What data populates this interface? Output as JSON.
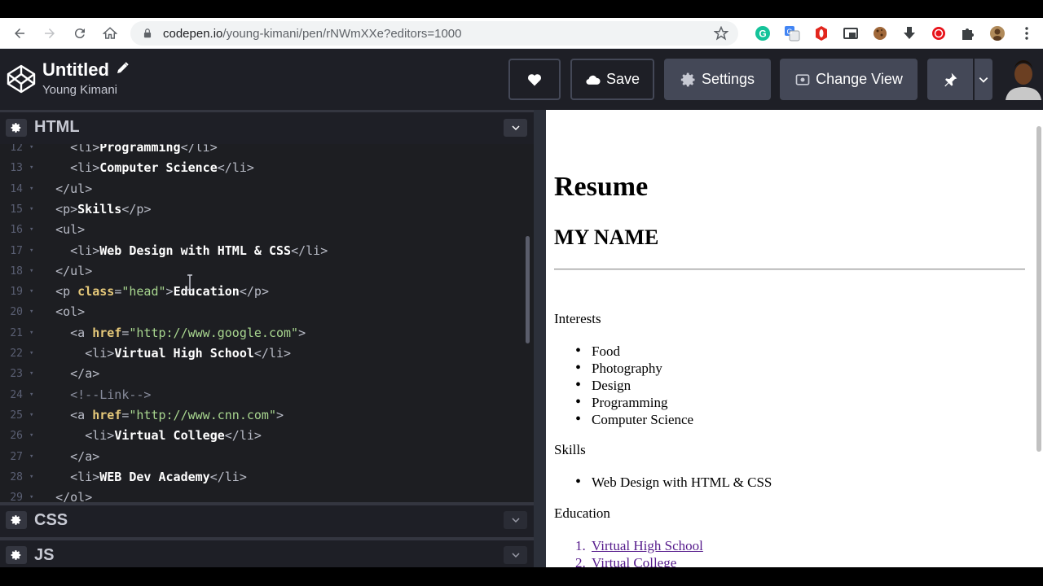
{
  "browser": {
    "url_host": "codepen.io",
    "url_path": "/young-kimani/pen/rNWmXXe?editors=1000",
    "extensions": [
      "grammarly-icon",
      "translate-icon",
      "opera-icon",
      "window-icon",
      "cookie-icon",
      "download-icon",
      "record-icon",
      "puzzle-icon",
      "profile-icon",
      "menu-icon"
    ]
  },
  "header": {
    "title": "Untitled",
    "author": "Young Kimani",
    "save_label": "Save",
    "settings_label": "Settings",
    "change_view_label": "Change View"
  },
  "editor": {
    "html_label": "HTML",
    "css_label": "CSS",
    "js_label": "JS",
    "lines": [
      {
        "n": "12",
        "indent": "    ",
        "parts": [
          [
            "t",
            "<"
          ],
          [
            "tn",
            "li"
          ],
          [
            "t",
            ">"
          ],
          [
            "c",
            "Programming"
          ],
          [
            "t",
            "</"
          ],
          [
            "tn",
            "li"
          ],
          [
            "t",
            ">"
          ]
        ]
      },
      {
        "n": "13",
        "indent": "    ",
        "parts": [
          [
            "t",
            "<"
          ],
          [
            "tn",
            "li"
          ],
          [
            "t",
            ">"
          ],
          [
            "c",
            "Computer Science"
          ],
          [
            "t",
            "</"
          ],
          [
            "tn",
            "li"
          ],
          [
            "t",
            ">"
          ]
        ]
      },
      {
        "n": "14",
        "indent": "  ",
        "parts": [
          [
            "t",
            "</"
          ],
          [
            "tn",
            "ul"
          ],
          [
            "t",
            ">"
          ]
        ]
      },
      {
        "n": "15",
        "indent": "  ",
        "parts": [
          [
            "t",
            "<"
          ],
          [
            "tn",
            "p"
          ],
          [
            "t",
            ">"
          ],
          [
            "c",
            "Skills"
          ],
          [
            "t",
            "</"
          ],
          [
            "tn",
            "p"
          ],
          [
            "t",
            ">"
          ]
        ]
      },
      {
        "n": "16",
        "indent": "  ",
        "parts": [
          [
            "t",
            "<"
          ],
          [
            "tn",
            "ul"
          ],
          [
            "t",
            ">"
          ]
        ]
      },
      {
        "n": "17",
        "indent": "    ",
        "parts": [
          [
            "t",
            "<"
          ],
          [
            "tn",
            "li"
          ],
          [
            "t",
            ">"
          ],
          [
            "c",
            "Web Design with HTML & CSS"
          ],
          [
            "t",
            "</"
          ],
          [
            "tn",
            "li"
          ],
          [
            "t",
            ">"
          ]
        ]
      },
      {
        "n": "18",
        "indent": "  ",
        "parts": [
          [
            "t",
            "</"
          ],
          [
            "tn",
            "ul"
          ],
          [
            "t",
            ">"
          ]
        ]
      },
      {
        "n": "19",
        "indent": "  ",
        "parts": [
          [
            "t",
            "<"
          ],
          [
            "tn",
            "p"
          ],
          [
            "c",
            " "
          ],
          [
            "attr",
            "class"
          ],
          [
            "t",
            "="
          ],
          [
            "str",
            "\"head\""
          ],
          [
            "t",
            ">"
          ],
          [
            "c",
            "Education"
          ],
          [
            "t",
            "</"
          ],
          [
            "tn",
            "p"
          ],
          [
            "t",
            ">"
          ]
        ]
      },
      {
        "n": "20",
        "indent": "  ",
        "parts": [
          [
            "t",
            "<"
          ],
          [
            "tn",
            "ol"
          ],
          [
            "t",
            ">"
          ]
        ]
      },
      {
        "n": "21",
        "indent": "    ",
        "parts": [
          [
            "t",
            "<"
          ],
          [
            "tn",
            "a"
          ],
          [
            "c",
            " "
          ],
          [
            "attr",
            "href"
          ],
          [
            "t",
            "="
          ],
          [
            "str",
            "\"http://www.google.com\""
          ],
          [
            "t",
            ">"
          ]
        ]
      },
      {
        "n": "22",
        "indent": "      ",
        "parts": [
          [
            "t",
            "<"
          ],
          [
            "tn",
            "li"
          ],
          [
            "t",
            ">"
          ],
          [
            "c",
            "Virtual High School"
          ],
          [
            "t",
            "</"
          ],
          [
            "tn",
            "li"
          ],
          [
            "t",
            ">"
          ]
        ]
      },
      {
        "n": "23",
        "indent": "    ",
        "parts": [
          [
            "t",
            "</"
          ],
          [
            "tn",
            "a"
          ],
          [
            "t",
            ">"
          ]
        ]
      },
      {
        "n": "24",
        "indent": "    ",
        "parts": [
          [
            "cm",
            "<!--Link-->"
          ]
        ]
      },
      {
        "n": "25",
        "indent": "    ",
        "parts": [
          [
            "t",
            "<"
          ],
          [
            "tn",
            "a"
          ],
          [
            "c",
            " "
          ],
          [
            "attr",
            "href"
          ],
          [
            "t",
            "="
          ],
          [
            "str",
            "\"http://www.cnn.com\""
          ],
          [
            "t",
            ">"
          ]
        ]
      },
      {
        "n": "26",
        "indent": "      ",
        "parts": [
          [
            "t",
            "<"
          ],
          [
            "tn",
            "li"
          ],
          [
            "t",
            ">"
          ],
          [
            "c",
            "Virtual College"
          ],
          [
            "t",
            "</"
          ],
          [
            "tn",
            "li"
          ],
          [
            "t",
            ">"
          ]
        ]
      },
      {
        "n": "27",
        "indent": "    ",
        "parts": [
          [
            "t",
            "</"
          ],
          [
            "tn",
            "a"
          ],
          [
            "t",
            ">"
          ]
        ]
      },
      {
        "n": "28",
        "indent": "    ",
        "parts": [
          [
            "t",
            "<"
          ],
          [
            "tn",
            "li"
          ],
          [
            "t",
            ">"
          ],
          [
            "c",
            "WEB Dev Academy"
          ],
          [
            "t",
            "</"
          ],
          [
            "tn",
            "li"
          ],
          [
            "t",
            ">"
          ]
        ]
      },
      {
        "n": "29",
        "indent": "  ",
        "parts": [
          [
            "t",
            "</"
          ],
          [
            "tn",
            "ol"
          ],
          [
            "t",
            ">"
          ]
        ]
      }
    ]
  },
  "preview": {
    "h1": "Resume",
    "h2": "MY NAME",
    "interests_label": "Interests",
    "interests": [
      "Food",
      "Photography",
      "Design",
      "Programming",
      "Computer Science"
    ],
    "skills_label": "Skills",
    "skills": [
      "Web Design with HTML & CSS"
    ],
    "education_label": "Education",
    "education": [
      {
        "num": "1.",
        "label": "Virtual High School"
      },
      {
        "num": "2.",
        "label": "Virtual College"
      }
    ]
  }
}
